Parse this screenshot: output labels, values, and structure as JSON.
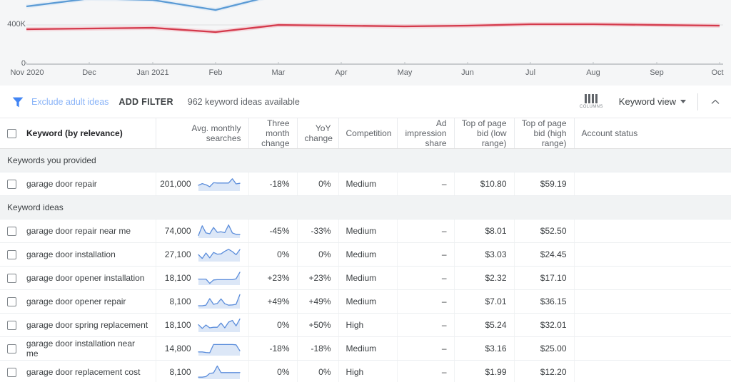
{
  "chart": {
    "y_labels": {
      "top": "400K",
      "zero": "0"
    },
    "x_ticks": [
      "Nov 2020",
      "Dec",
      "Jan 2021",
      "Feb",
      "Mar",
      "Apr",
      "May",
      "Jun",
      "Jul",
      "Aug",
      "Sep",
      "Oct"
    ],
    "colors": {
      "series_blue": "#5b9bd5",
      "series_red": "#d4394b",
      "background": "#f5f6f7",
      "gridline": "#e0e0e0",
      "axis": "#9aa0a6"
    }
  },
  "chart_data": {
    "type": "line",
    "title": "",
    "xlabel": "",
    "ylabel": "",
    "ylim": [
      0,
      800000
    ],
    "grid": true,
    "legend": "none",
    "x": [
      "Nov 2020",
      "Dec",
      "Jan 2021",
      "Feb",
      "Mar",
      "Apr",
      "May",
      "Jun",
      "Jul",
      "Aug",
      "Sep",
      "Oct"
    ],
    "series": [
      {
        "name": "blue-series",
        "color": "#5b9bd5",
        "values": [
          620000,
          700000,
          690000,
          600000,
          740000,
          null,
          null,
          null,
          null,
          null,
          null,
          null
        ]
      },
      {
        "name": "red-series",
        "color": "#d4394b",
        "values": [
          388000,
          390000,
          393000,
          372000,
          405000,
          400000,
          398000,
          402000,
          406000,
          406000,
          404000,
          402000
        ]
      }
    ]
  },
  "filter_bar": {
    "funnel_icon": "filter-funnel-icon",
    "exclude_adult_ideas": "Exclude adult ideas",
    "add_filter": "ADD FILTER",
    "ideas_available": "962 keyword ideas available",
    "columns_label": "COLUMNS",
    "view_label": "Keyword view",
    "collapse_icon": "chevron-up-icon"
  },
  "table": {
    "headers": [
      "Keyword (by relevance)",
      "Avg. monthly searches",
      "Three month change",
      "YoY change",
      "Competition",
      "Ad impression share",
      "Top of page bid (low range)",
      "Top of page bid (high range)",
      "Account status"
    ],
    "groups": [
      {
        "label": "Keywords you provided",
        "rows": [
          {
            "keyword": "garage door repair",
            "searches": "201,000",
            "three_month": "-18%",
            "yoy": "0%",
            "competition": "Medium",
            "ad_share": "–",
            "bid_low": "$10.80",
            "bid_high": "$59.19",
            "account_status": "",
            "spark": [
              40,
              52,
              44,
              30,
              58,
              56,
              56,
              56,
              56,
              86,
              50,
              54
            ]
          }
        ]
      },
      {
        "label": "Keyword ideas",
        "rows": [
          {
            "keyword": "garage door repair near me",
            "searches": "74,000",
            "three_month": "-45%",
            "yoy": "-33%",
            "competition": "Medium",
            "ad_share": "–",
            "bid_low": "$8.01",
            "bid_high": "$52.50",
            "account_status": "",
            "spark": [
              18,
              86,
              36,
              30,
              74,
              40,
              44,
              38,
              92,
              36,
              26,
              24
            ]
          },
          {
            "keyword": "garage door installation",
            "searches": "27,100",
            "three_month": "0%",
            "yoy": "0%",
            "competition": "Medium",
            "ad_share": "–",
            "bid_low": "$3.03",
            "bid_high": "$24.45",
            "account_status": "",
            "spark": [
              48,
              22,
              60,
              26,
              64,
              52,
              54,
              72,
              86,
              70,
              48,
              84
            ]
          },
          {
            "keyword": "garage door opener installation",
            "searches": "18,100",
            "three_month": "+23%",
            "yoy": "+23%",
            "competition": "Medium",
            "ad_share": "–",
            "bid_low": "$2.32",
            "bid_high": "$17.10",
            "account_status": "",
            "spark": [
              42,
              42,
              42,
              12,
              36,
              38,
              38,
              38,
              38,
              38,
              44,
              90
            ]
          },
          {
            "keyword": "garage door opener repair",
            "searches": "8,100",
            "three_month": "+49%",
            "yoy": "+49%",
            "competition": "Medium",
            "ad_share": "–",
            "bid_low": "$7.01",
            "bid_high": "$36.15",
            "account_status": "",
            "spark": [
              20,
              20,
              24,
              70,
              30,
              36,
              68,
              34,
              24,
              26,
              30,
              98
            ]
          },
          {
            "keyword": "garage door spring replacement",
            "searches": "18,100",
            "three_month": "0%",
            "yoy": "+50%",
            "competition": "High",
            "ad_share": "–",
            "bid_low": "$5.24",
            "bid_high": "$32.01",
            "account_status": "",
            "spark": [
              52,
              26,
              50,
              30,
              34,
              34,
              64,
              30,
              70,
              82,
              44,
              92
            ]
          },
          {
            "keyword": "garage door installation near me",
            "searches": "14,800",
            "three_month": "-18%",
            "yoy": "-18%",
            "competition": "Medium",
            "ad_share": "–",
            "bid_low": "$3.16",
            "bid_high": "$25.00",
            "account_status": "",
            "spark": [
              26,
              26,
              22,
              20,
              78,
              78,
              78,
              78,
              78,
              78,
              76,
              34
            ]
          },
          {
            "keyword": "garage door replacement cost",
            "searches": "8,100",
            "three_month": "0%",
            "yoy": "0%",
            "competition": "High",
            "ad_share": "–",
            "bid_low": "$1.99",
            "bid_high": "$12.20",
            "account_status": "",
            "spark": [
              14,
              14,
              18,
              40,
              44,
              92,
              46,
              46,
              46,
              46,
              46,
              46
            ]
          }
        ]
      }
    ]
  }
}
